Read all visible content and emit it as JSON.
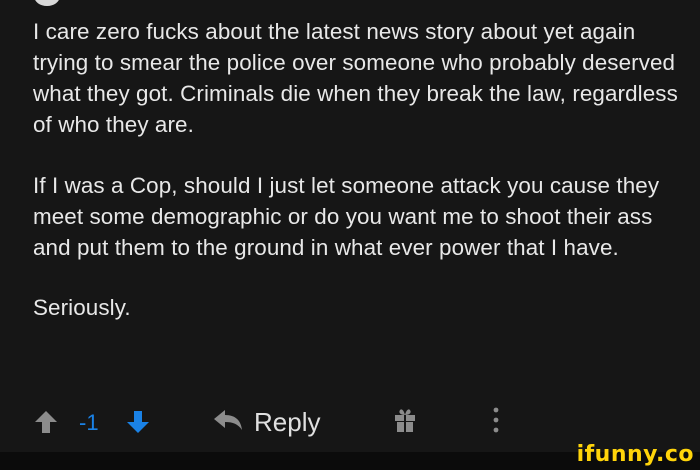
{
  "comment": {
    "paragraphs": [
      "I care zero fucks about the latest news story about yet again trying to smear the police over someone who probably deserved what they got. Criminals die when they break the law, regardless of who they are.",
      "If I was a Cop, should I just let someone attack you cause they meet some demographic or do you want me to shoot their ass and put them to the ground in what ever power that I have.",
      "Seriously."
    ]
  },
  "actions": {
    "score": "-1",
    "reply_label": "Reply",
    "upvote_icon": "arrow-up-icon",
    "downvote_icon": "arrow-down-icon",
    "reply_icon": "reply-arrow-icon",
    "gift_icon": "gift-icon",
    "more_icon": "more-vertical-icon"
  },
  "watermark": {
    "text": "ifunny.co"
  },
  "colors": {
    "background": "#161616",
    "text": "#e8e8e8",
    "score": "#1a82e6",
    "downvote": "#1a82e6",
    "icons": "#8c8c8c",
    "watermark": "#ffd40a"
  }
}
